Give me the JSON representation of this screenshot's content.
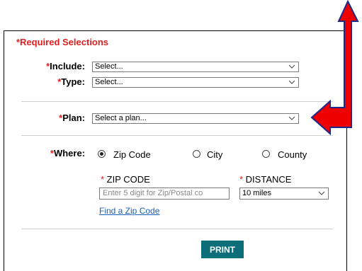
{
  "form": {
    "required_title": "*Required Selections",
    "include": {
      "label": "Include:",
      "value": "Select..."
    },
    "type": {
      "label": "Type:",
      "value": "Select..."
    },
    "plan": {
      "label": "Plan:",
      "value": "Select a plan..."
    },
    "where": {
      "label": "Where:",
      "options": [
        "Zip Code",
        "City",
        "County"
      ],
      "selected": "Zip Code"
    },
    "zip_code": {
      "label": "ZIP CODE",
      "placeholder": "Enter 5 digit for Zip/Postal co"
    },
    "distance": {
      "label": "DISTANCE",
      "value": "10 miles"
    },
    "find_zip_link": "Find a Zip Code",
    "print_label": "PRINT"
  },
  "colors": {
    "required_red": "#e02020",
    "link_blue": "#1a5fb4",
    "print_teal": "#0b6e78",
    "arrow_red": "#ee0000",
    "arrow_outline": "#1a2a8a"
  },
  "icons": {
    "dropdown": "chevron-down-icon",
    "annotation": "red-arrow-icon"
  }
}
